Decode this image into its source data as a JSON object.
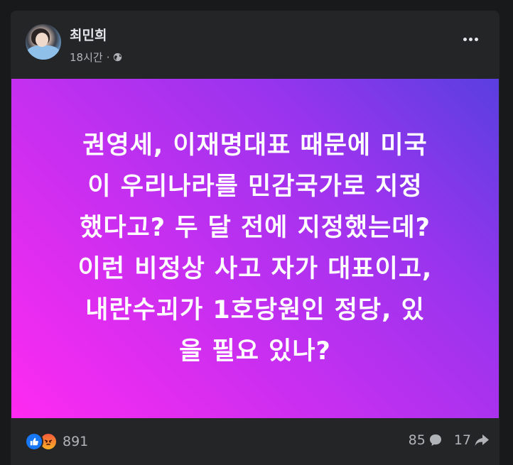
{
  "author": {
    "name": "최민희",
    "time": "18시간",
    "separator": "·",
    "privacy_icon": "globe-icon"
  },
  "post": {
    "lines": [
      "권영세, 이재명대표 때문에 미국",
      "이 우리나라를 민감국가로 지정",
      "했다고? 두 달 전에 지정했는데?",
      "이런 비정상 사고 자가 대표이고,",
      "내란수괴가 1호당원인 정당, 있",
      "을 필요 있나?"
    ],
    "gradient": [
      "#ff2af1",
      "#9a34ee",
      "#5a3fe0"
    ]
  },
  "footer": {
    "reactions": [
      "like-icon",
      "angry-icon"
    ],
    "reaction_count": "891",
    "comment_count": "85",
    "comment_icon": "comment-icon",
    "share_count": "17",
    "share_icon": "share-icon"
  },
  "colors": {
    "background": "#18191a",
    "card": "#242526",
    "primary_text": "#e4e6eb",
    "secondary_text": "#b0b3b8"
  }
}
